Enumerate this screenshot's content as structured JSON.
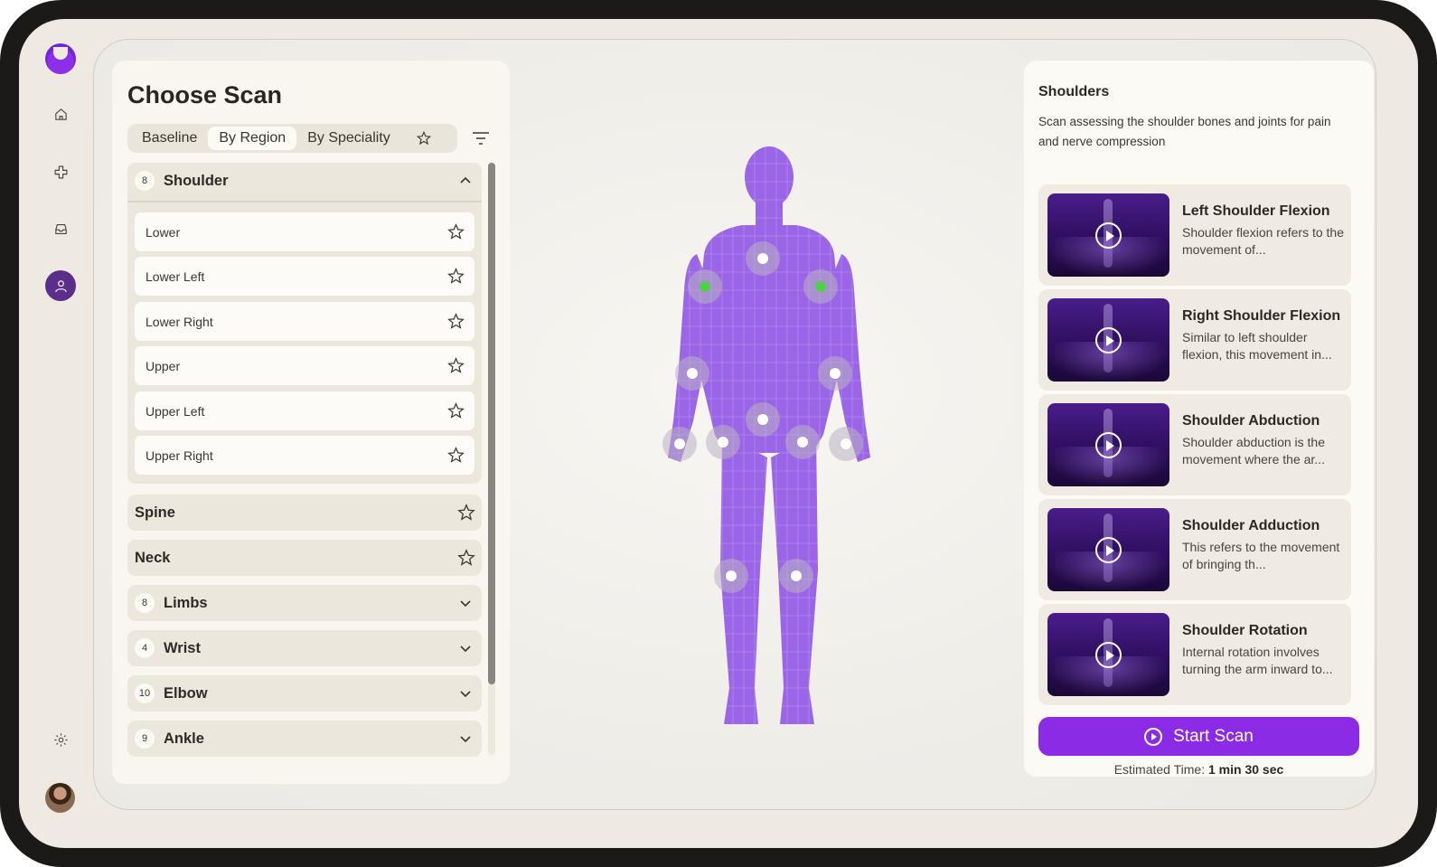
{
  "nav": {
    "logo": "brand-logo",
    "items": [
      {
        "name": "home-icon",
        "active": false
      },
      {
        "name": "medical-cross-icon",
        "active": false
      },
      {
        "name": "inbox-icon",
        "active": false
      },
      {
        "name": "user-icon",
        "active": true
      }
    ],
    "settings": "gear-icon",
    "avatar": "user-avatar"
  },
  "scan_panel": {
    "title": "Choose Scan",
    "tabs": [
      {
        "label": "Baseline",
        "active": false
      },
      {
        "label": "By Region",
        "active": true
      },
      {
        "label": "By Speciality",
        "active": false
      }
    ],
    "groups": [
      {
        "count": "8",
        "name": "Shoulder",
        "expanded": true,
        "items": [
          "Lower",
          "Lower Left",
          "Lower Right",
          "Upper",
          "Upper Left",
          "Upper Right"
        ]
      },
      {
        "count": "",
        "name": "Spine",
        "favoritable": true
      },
      {
        "count": "",
        "name": "Neck",
        "favoritable": true
      },
      {
        "count": "8",
        "name": "Limbs"
      },
      {
        "count": "4",
        "name": "Wrist"
      },
      {
        "count": "10",
        "name": "Elbow"
      },
      {
        "count": "9",
        "name": "Ankle"
      }
    ]
  },
  "body_map": {
    "highlight_color": "#4fd047",
    "body_color": "#9a65e6",
    "points": [
      {
        "name": "neck",
        "selected": false
      },
      {
        "name": "left-shoulder",
        "selected": true
      },
      {
        "name": "right-shoulder",
        "selected": true
      },
      {
        "name": "left-elbow",
        "selected": false
      },
      {
        "name": "right-elbow",
        "selected": false
      },
      {
        "name": "spine",
        "selected": false
      },
      {
        "name": "left-wrist",
        "selected": false
      },
      {
        "name": "right-wrist",
        "selected": false
      },
      {
        "name": "left-hip",
        "selected": false
      },
      {
        "name": "right-hip",
        "selected": false
      },
      {
        "name": "left-knee",
        "selected": false
      },
      {
        "name": "right-knee",
        "selected": false
      }
    ]
  },
  "detail": {
    "title": "Shoulders",
    "description": "Scan assessing the shoulder bones and joints for pain and nerve compression",
    "exercises": [
      {
        "title": "Left Shoulder Flexion",
        "desc": "Shoulder flexion refers to the movement of..."
      },
      {
        "title": "Right Shoulder Flexion",
        "desc": "Similar to left shoulder flexion, this movement in..."
      },
      {
        "title": "Shoulder Abduction",
        "desc": "Shoulder abduction is the movement where the ar..."
      },
      {
        "title": "Shoulder Adduction",
        "desc": "This refers to the movement of bringing th..."
      },
      {
        "title": "Shoulder Rotation",
        "desc": "Internal rotation involves turning the arm inward to..."
      }
    ],
    "start_label": "Start Scan",
    "estimate_label": "Estimated Time:",
    "estimate_value": "1 min 30 sec",
    "accent": "#8c2be6"
  }
}
